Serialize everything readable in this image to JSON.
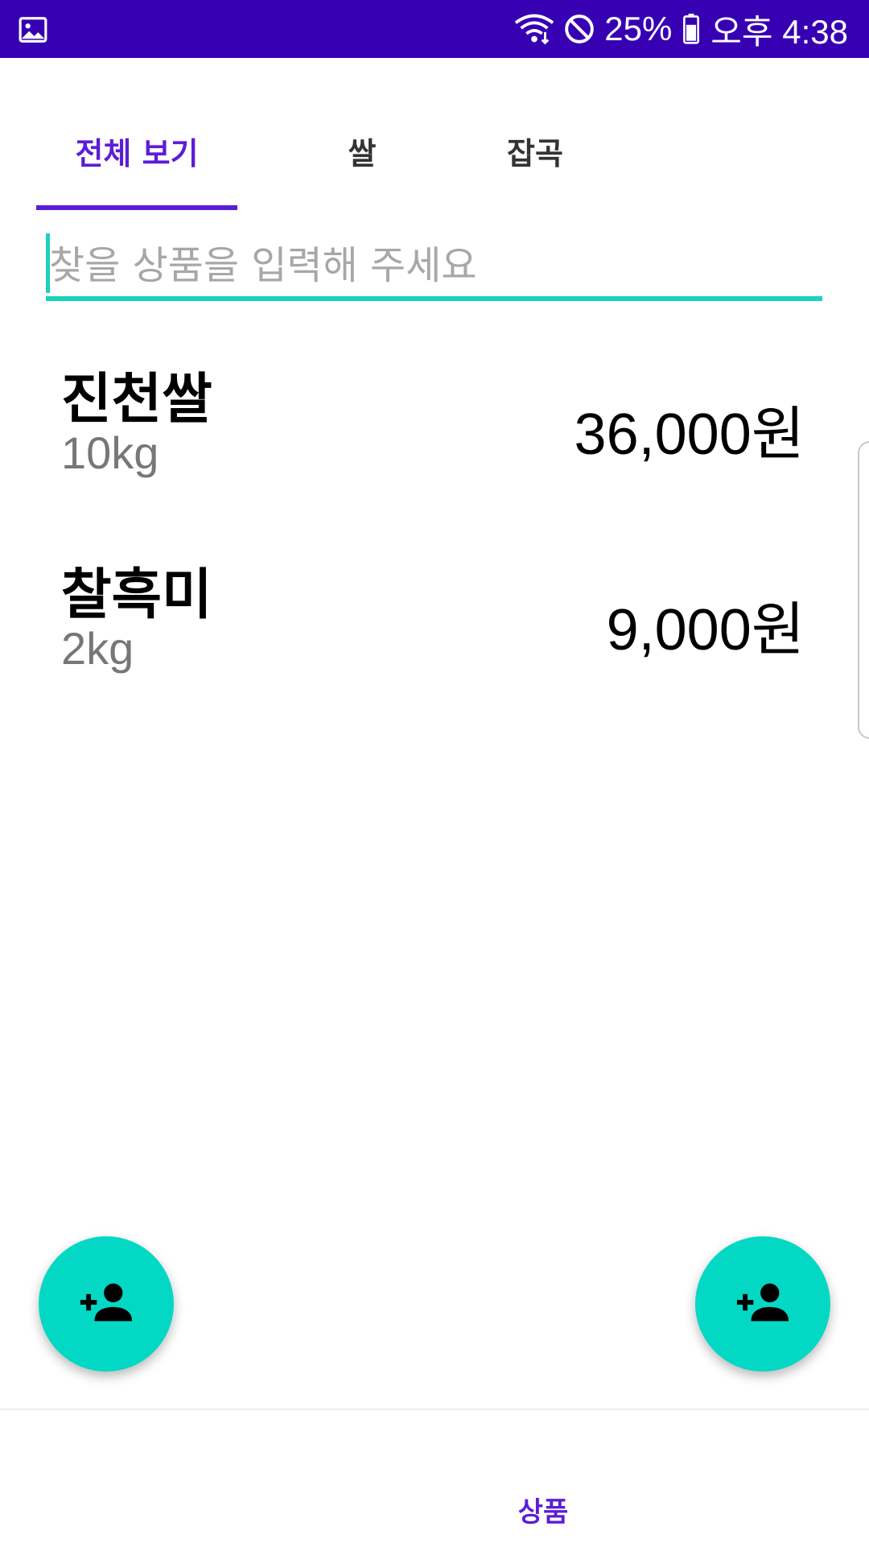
{
  "status_bar": {
    "left_icon": "gallery-icon",
    "battery_percent": "25%",
    "time": "오후 4:38",
    "icons": [
      "wifi-icon",
      "do-not-disturb-icon",
      "battery-icon"
    ],
    "background_color": "#3700b3"
  },
  "tabs": [
    {
      "label": "전체 보기",
      "active": true
    },
    {
      "label": "쌀",
      "active": false
    },
    {
      "label": "잡곡",
      "active": false
    }
  ],
  "search": {
    "placeholder": "찾을 상품을 입력해 주세요",
    "value": ""
  },
  "products": [
    {
      "name": "진천쌀",
      "weight": "10kg",
      "price": "36,000원"
    },
    {
      "name": "찰흑미",
      "weight": "2kg",
      "price": "9,000원"
    }
  ],
  "fabs": [
    {
      "icon": "add-person-icon"
    },
    {
      "icon": "add-person-icon"
    }
  ],
  "bottom_nav": {
    "items": [
      {
        "label": "상품",
        "active": true
      }
    ]
  },
  "colors": {
    "accent": "#5c1ed4",
    "teal": "#03d8c5",
    "status_bar": "#3700b3"
  }
}
